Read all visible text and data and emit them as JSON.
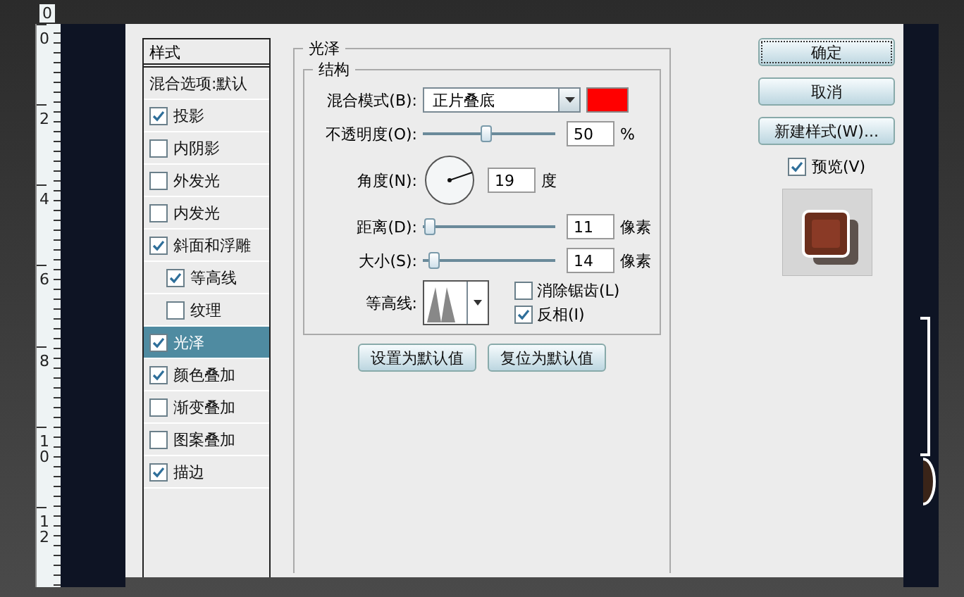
{
  "ruler": {
    "top_label": "0",
    "marks": [
      "0",
      "2",
      "4",
      "6",
      "8",
      "10",
      "12"
    ]
  },
  "styles_panel": {
    "header": "样式",
    "items": [
      {
        "label": "混合选项:默认",
        "kind": "plain",
        "selected": false
      },
      {
        "label": "投影",
        "kind": "check",
        "checked": true,
        "selected": false
      },
      {
        "label": "内阴影",
        "kind": "check",
        "checked": false,
        "selected": false
      },
      {
        "label": "外发光",
        "kind": "check",
        "checked": false,
        "selected": false
      },
      {
        "label": "内发光",
        "kind": "check",
        "checked": false,
        "selected": false
      },
      {
        "label": "斜面和浮雕",
        "kind": "check",
        "checked": true,
        "selected": false,
        "children": [
          {
            "label": "等高线",
            "kind": "check",
            "checked": true,
            "selected": false
          },
          {
            "label": "纹理",
            "kind": "check",
            "checked": false,
            "selected": false
          }
        ]
      },
      {
        "label": "光泽",
        "kind": "check",
        "checked": true,
        "selected": true
      },
      {
        "label": "颜色叠加",
        "kind": "check",
        "checked": true,
        "selected": false
      },
      {
        "label": "渐变叠加",
        "kind": "check",
        "checked": false,
        "selected": false
      },
      {
        "label": "图案叠加",
        "kind": "check",
        "checked": false,
        "selected": false
      },
      {
        "label": "描边",
        "kind": "check",
        "checked": true,
        "selected": false
      }
    ]
  },
  "section": {
    "title": "光泽",
    "group": "结构",
    "blend_mode": {
      "label": "混合模式(B):",
      "value": "正片叠底",
      "color": "#ff0000"
    },
    "opacity": {
      "label": "不透明度(O):",
      "level": 0.48,
      "value": "50",
      "unit": "%"
    },
    "angle": {
      "label": "角度(N):",
      "value": "19",
      "unit": "度"
    },
    "distance": {
      "label": "距离(D):",
      "level": 0.05,
      "value": "11",
      "unit": "像素"
    },
    "size": {
      "label": "大小(S):",
      "level": 0.08,
      "value": "14",
      "unit": "像素"
    },
    "contour": {
      "label": "等高线:"
    },
    "anti_alias": {
      "label": "消除锯齿(L)",
      "checked": false
    },
    "invert": {
      "label": "反相(I)",
      "checked": true
    },
    "buttons": [
      "设置为默认值",
      "复位为默认值"
    ]
  },
  "actions": {
    "ok": "确定",
    "cancel": "取消",
    "new_style": "新建样式(W)...",
    "preview": {
      "label": "预览(V)",
      "checked": true
    }
  }
}
